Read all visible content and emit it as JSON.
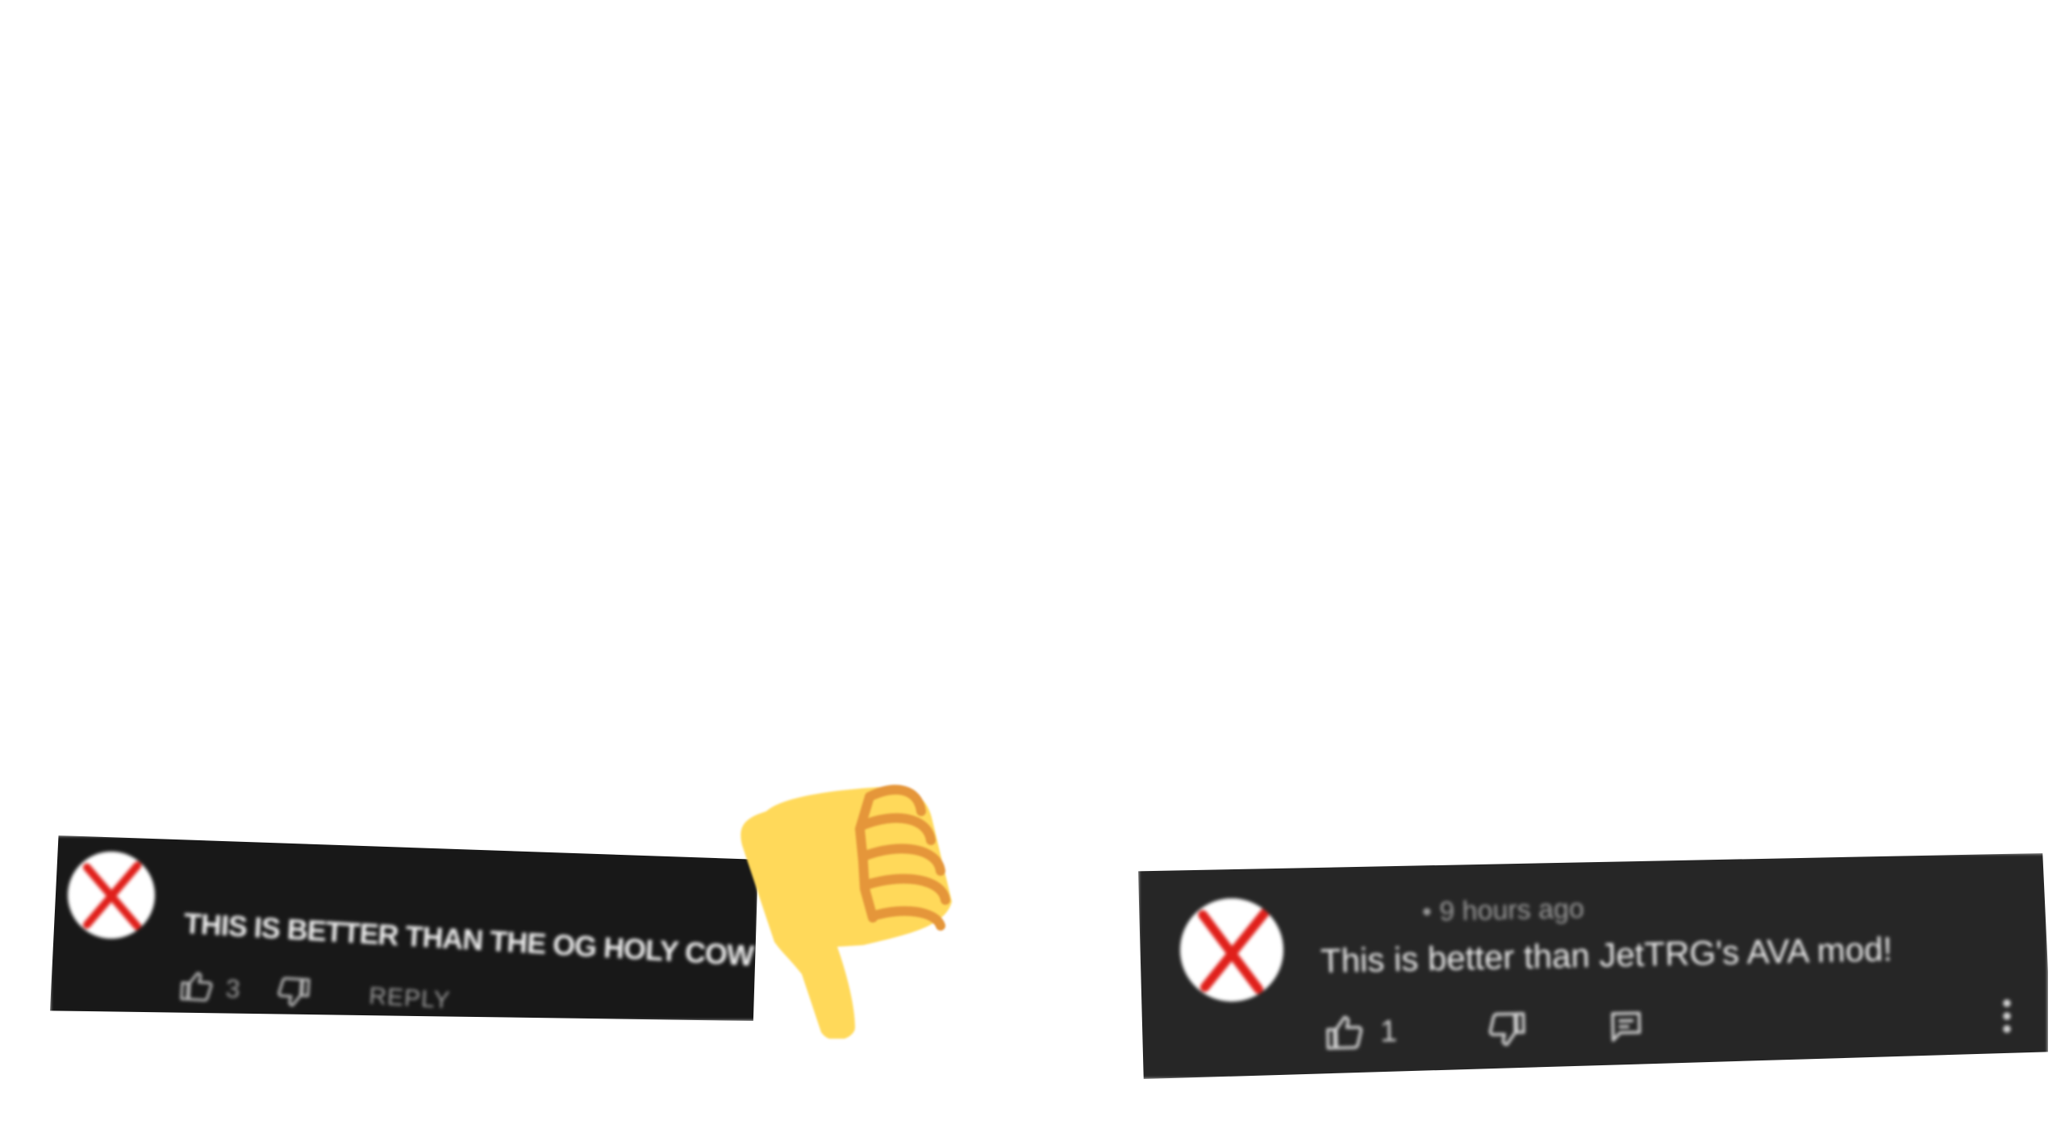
{
  "comments": [
    {
      "avatar_icon": "red-x-avatar-icon",
      "text": "THIS IS BETTER THAN THE OG HOLY COW",
      "like_count": "3",
      "reply_label": "REPLY",
      "background": "#181818"
    },
    {
      "avatar_icon": "red-x-avatar-icon",
      "timestamp": "• 9 hours ago",
      "text": "This is better than JetTRG's AVA mod!",
      "like_count": "1",
      "background": "#262626"
    }
  ],
  "sticker": {
    "icon": "thumbs-down-emoji",
    "color": "#FFD95A",
    "finger_color": "#E5963A"
  },
  "colors": {
    "avatar_x": "#E0201B",
    "text": "#ECECEC",
    "muted": "#9A9A9A"
  }
}
